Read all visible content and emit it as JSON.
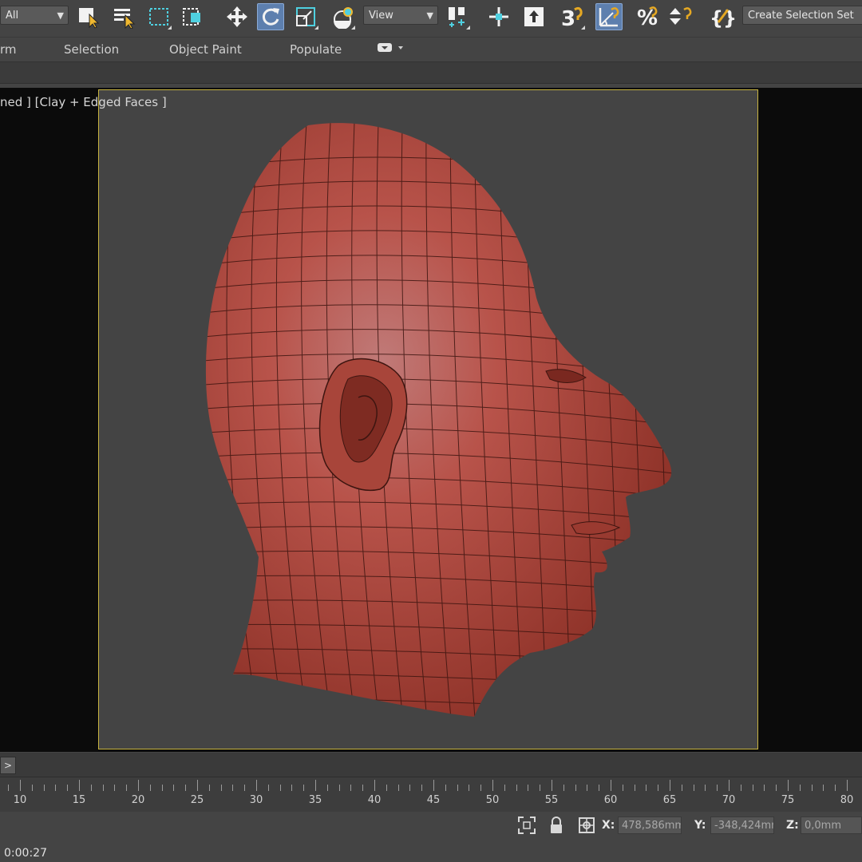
{
  "toolbar": {
    "selection_filter": "All",
    "ref_coord_system": "View",
    "named_selection_placeholder": "Create Selection Set"
  },
  "ribbon": {
    "tabs": [
      "rm",
      "Selection",
      "Object Paint",
      "Populate"
    ]
  },
  "viewport": {
    "label": "ned ] [Clay + Edged Faces ]",
    "shading": "Clay + Edged Faces",
    "model_color": "#b8483c",
    "frame_color": "#c8b440"
  },
  "time_slider": {
    "button": ">"
  },
  "trackbar": {
    "ticks": [
      "10",
      "15",
      "20",
      "25",
      "30",
      "35",
      "40",
      "45",
      "50",
      "55",
      "60",
      "65",
      "70",
      "75",
      "80"
    ]
  },
  "status": {
    "x_label": "X:",
    "x_value": "478,586mm",
    "y_label": "Y:",
    "y_value": "-348,424mm",
    "z_label": "Z:",
    "z_value": "0,0mm",
    "time": "0:00:27"
  },
  "colors": {
    "accent_active": "#5d7fae",
    "highlight_yellow": "#e5a823",
    "background": "#444444"
  }
}
